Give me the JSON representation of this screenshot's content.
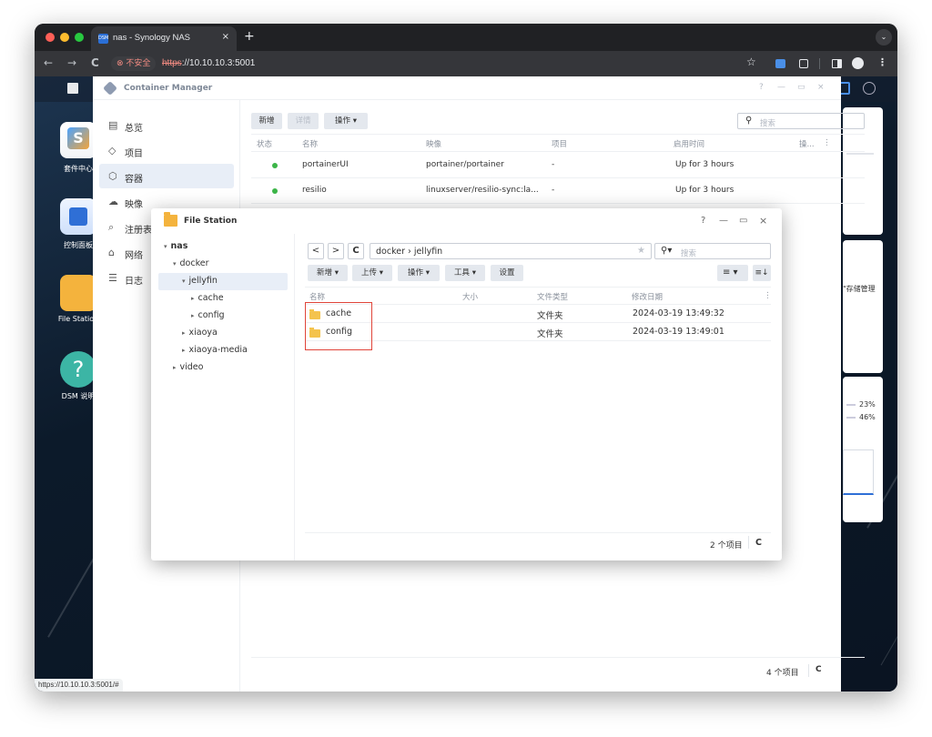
{
  "browser": {
    "tab_title": "nas - Synology NAS",
    "tab_close": "×",
    "new_tab": "+",
    "tab_menu": "⌄",
    "back": "←",
    "forward": "→",
    "reload": "C",
    "security_label": "⊗ 不安全",
    "url_scheme": "https",
    "url_rest": "://10.10.10.3:5001",
    "bookmark_icon": "☆",
    "status_url": "https://10.10.10.3:5001/#"
  },
  "desktop": {
    "icons": [
      {
        "label": "套件中心",
        "icon": "package-center-icon"
      },
      {
        "label": "控制面板",
        "icon": "control-panel-icon"
      },
      {
        "label": "File Station",
        "icon": "file-station-icon"
      },
      {
        "label": "DSM 说明",
        "icon": "help-icon"
      }
    ],
    "widget_storage_label": "\"存储管理",
    "widget_pct1": "23%",
    "widget_pct2": "46%"
  },
  "container_manager": {
    "title": "Container Manager",
    "window_controls": [
      "?",
      "—",
      "▭",
      "×"
    ],
    "sidebar": [
      {
        "label": "总览",
        "icon": "overview-icon",
        "glyph": "▤"
      },
      {
        "label": "项目",
        "icon": "project-icon",
        "glyph": "◇"
      },
      {
        "label": "容器",
        "icon": "container-icon",
        "glyph": "⬡",
        "active": true
      },
      {
        "label": "映像",
        "icon": "image-icon",
        "glyph": "☁"
      },
      {
        "label": "注册表",
        "icon": "registry-icon",
        "glyph": "⌕"
      },
      {
        "label": "网络",
        "icon": "network-icon",
        "glyph": "⌂"
      },
      {
        "label": "日志",
        "icon": "log-icon",
        "glyph": "☰"
      }
    ],
    "toolbar": {
      "add": "新增",
      "details": "详情",
      "action": "操作 ▾"
    },
    "search_placeholder": "搜索",
    "columns": [
      "状态",
      "名称",
      "映像",
      "项目",
      "启用时间",
      "操..."
    ],
    "rows": [
      {
        "name": "portainerUI",
        "image": "portainer/portainer",
        "project": "-",
        "uptime": "Up for 3 hours",
        "status_color": "#3cb548"
      },
      {
        "name": "resilio",
        "image": "linuxserver/resilio-sync:la...",
        "project": "-",
        "uptime": "Up for 3 hours",
        "status_color": "#3cb548"
      }
    ],
    "footer_count": "4 个项目",
    "footer_refresh": "C"
  },
  "file_station": {
    "title": "File Station",
    "window_controls": [
      "?",
      "—",
      "▭",
      "×"
    ],
    "tree": [
      {
        "label": "nas",
        "level": 0,
        "caret": "▾"
      },
      {
        "label": "docker",
        "level": 1,
        "caret": "▾"
      },
      {
        "label": "jellyfin",
        "level": 2,
        "caret": "▾",
        "selected": true
      },
      {
        "label": "cache",
        "level": 3,
        "caret": "▸"
      },
      {
        "label": "config",
        "level": 3,
        "caret": "▸"
      },
      {
        "label": "xiaoya",
        "level": 2,
        "caret": "▸"
      },
      {
        "label": "xiaoya-media",
        "level": 2,
        "caret": "▸"
      },
      {
        "label": "video",
        "level": 1,
        "caret": "▸"
      }
    ],
    "nav": {
      "back": "<",
      "forward": ">",
      "refresh": "C"
    },
    "path": "docker › jellyfin",
    "search_placeholder": "搜索",
    "toolbar": {
      "add": "新增 ▾",
      "upload": "上传 ▾",
      "action": "操作 ▾",
      "tools": "工具 ▾",
      "settings": "设置"
    },
    "columns": [
      "名称",
      "大小",
      "文件类型",
      "修改日期"
    ],
    "files": [
      {
        "name": "cache",
        "size": "",
        "type": "文件夹",
        "modified": "2024-03-19 13:49:32"
      },
      {
        "name": "config",
        "size": "",
        "type": "文件夹",
        "modified": "2024-03-19 13:49:01"
      }
    ],
    "footer_count": "2 个项目",
    "footer_refresh": "C"
  }
}
